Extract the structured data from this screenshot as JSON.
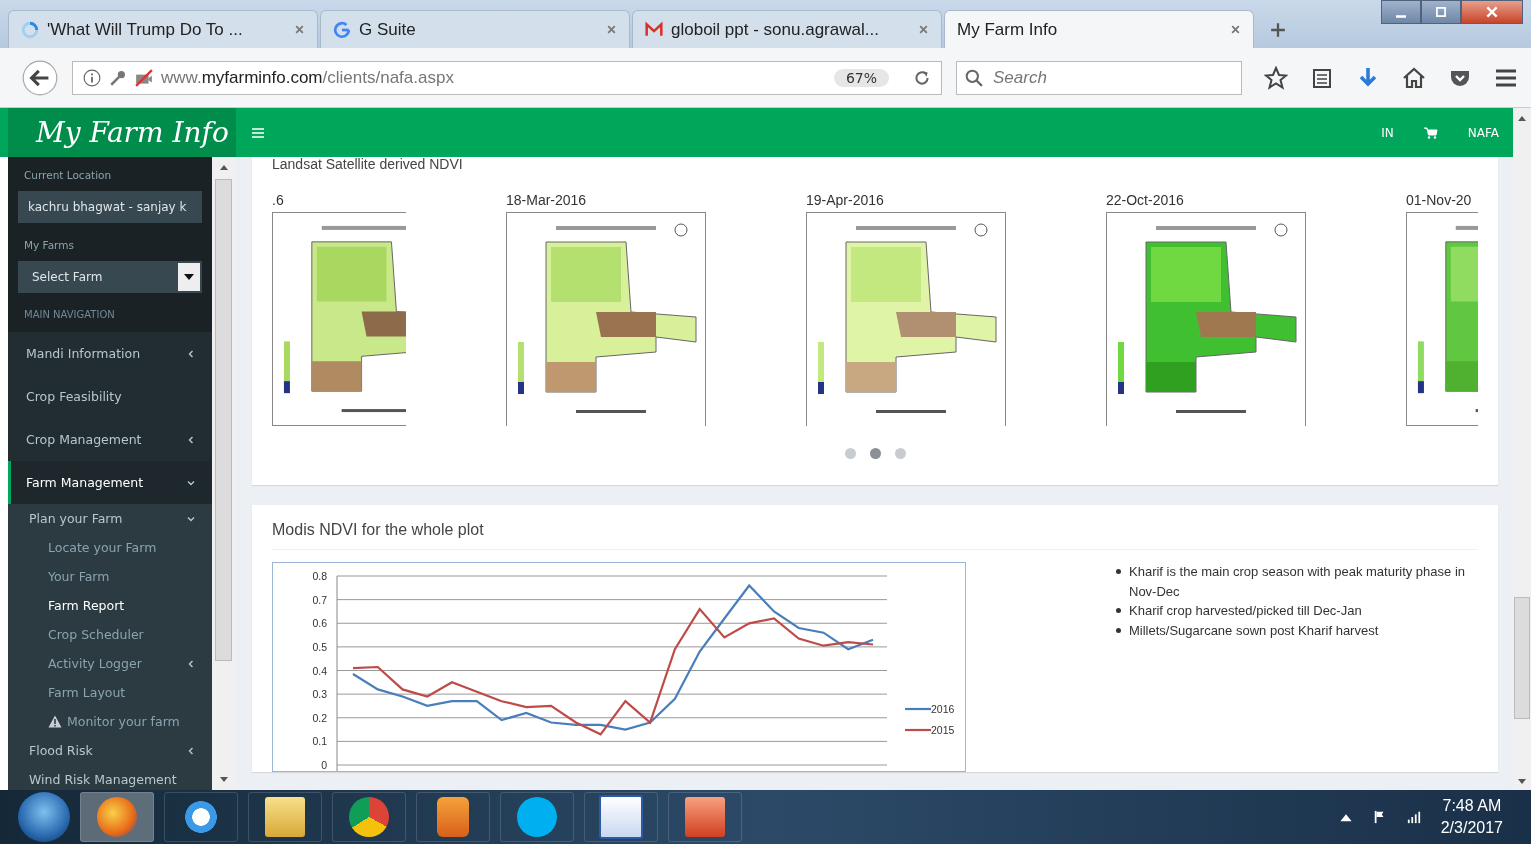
{
  "browser": {
    "tabs": [
      {
        "title": "'What Will Trump Do To ...",
        "selected": false
      },
      {
        "title": "G Suite",
        "selected": false
      },
      {
        "title": "globoil ppt - sonu.agrawal...",
        "selected": false
      },
      {
        "title": "My Farm Info",
        "selected": true
      }
    ],
    "url_prefix": "www.",
    "url_domain": "myfarminfo.com",
    "url_path": "/clients/nafa.aspx",
    "zoom": "67%",
    "search": {
      "placeholder": "Search"
    }
  },
  "header": {
    "logo": "My Farm Info",
    "links": [
      "IN",
      "NAFA"
    ]
  },
  "sidebar": {
    "items": [
      {
        "kind": "label",
        "text": "Current Location"
      },
      {
        "kind": "field",
        "text": "kachru bhagwat - sanjay k"
      },
      {
        "kind": "label",
        "text": "My Farms"
      },
      {
        "kind": "select",
        "text": "Select Farm"
      },
      {
        "kind": "heading",
        "text": "MAIN NAVIGATION"
      }
    ],
    "nav": [
      {
        "label": "Mandi Information",
        "kind": "group",
        "expanded": false,
        "selected": false
      },
      {
        "label": "Crop Feasibility",
        "kind": "link",
        "selected": false
      },
      {
        "label": "Crop Management",
        "kind": "group",
        "expanded": false,
        "selected": false
      },
      {
        "label": "Farm Management",
        "kind": "group",
        "expanded": true,
        "selected": true,
        "children": [
          {
            "label": "Plan your Farm",
            "kind": "group",
            "expanded": true,
            "selected": false,
            "children": [
              {
                "label": "Locate your Farm",
                "kind": "link",
                "selected": false
              },
              {
                "label": "Your Farm",
                "kind": "link",
                "selected": false
              },
              {
                "label": "Farm Report",
                "kind": "link",
                "selected": true
              },
              {
                "label": "Crop Scheduler",
                "kind": "link",
                "selected": false
              },
              {
                "label": "Activity Logger",
                "kind": "group",
                "expanded": false,
                "selected": false
              },
              {
                "label": "Farm Layout",
                "kind": "link",
                "selected": false
              },
              {
                "label": "Monitor your farm",
                "kind": "warning",
                "selected": false
              }
            ]
          },
          {
            "label": "Flood Risk",
            "kind": "group",
            "expanded": false,
            "selected": false
          },
          {
            "label": "Wind Risk Management",
            "kind": "link",
            "selected": false
          }
        ]
      }
    ]
  },
  "landsat": {
    "title": "Landsat Satellite derived NDVI",
    "slides": [
      {
        "date": ".6"
      },
      {
        "date": "18-Mar-2016"
      },
      {
        "date": "19-Apr-2016"
      },
      {
        "date": "22-Oct-2016"
      },
      {
        "date": "01-Nov-20"
      }
    ],
    "dots": [
      {
        "selected": false
      },
      {
        "selected": true
      },
      {
        "selected": false
      }
    ]
  },
  "modis": {
    "title": "Modis NDVI for the whole plot",
    "chart_data": {
      "type": "line",
      "grid": true,
      "legend": true,
      "ylim": [
        0,
        0.8
      ],
      "yticks": [
        0,
        0.1,
        0.2,
        0.3,
        0.4,
        0.5,
        0.6,
        0.7,
        0.8
      ],
      "series": [
        {
          "name": "2016",
          "color": "#4a7ebb",
          "values": [
            0.385,
            0.32,
            0.29,
            0.25,
            0.27,
            0.27,
            0.19,
            0.22,
            0.18,
            0.17,
            0.17,
            0.15,
            0.18,
            0.28,
            0.48,
            0.62,
            0.76,
            0.65,
            0.58,
            0.56,
            0.49,
            0.53
          ]
        },
        {
          "name": "2015",
          "color": "#be4b48",
          "values": [
            0.41,
            0.415,
            0.32,
            0.29,
            0.35,
            0.31,
            0.27,
            0.245,
            0.25,
            0.18,
            0.13,
            0.27,
            0.18,
            0.49,
            0.66,
            0.54,
            0.6,
            0.62,
            0.535,
            0.505,
            0.52,
            0.51
          ]
        }
      ]
    },
    "notes": [
      "Kharif is the main crop season with peak maturity phase in Nov-Dec",
      "Kharif crop harvested/picked till Dec-Jan",
      "Millets/Sugarcane sown post Kharif harvest"
    ]
  },
  "taskbar": {
    "time": "7:48 AM",
    "date": "2/3/2017"
  }
}
